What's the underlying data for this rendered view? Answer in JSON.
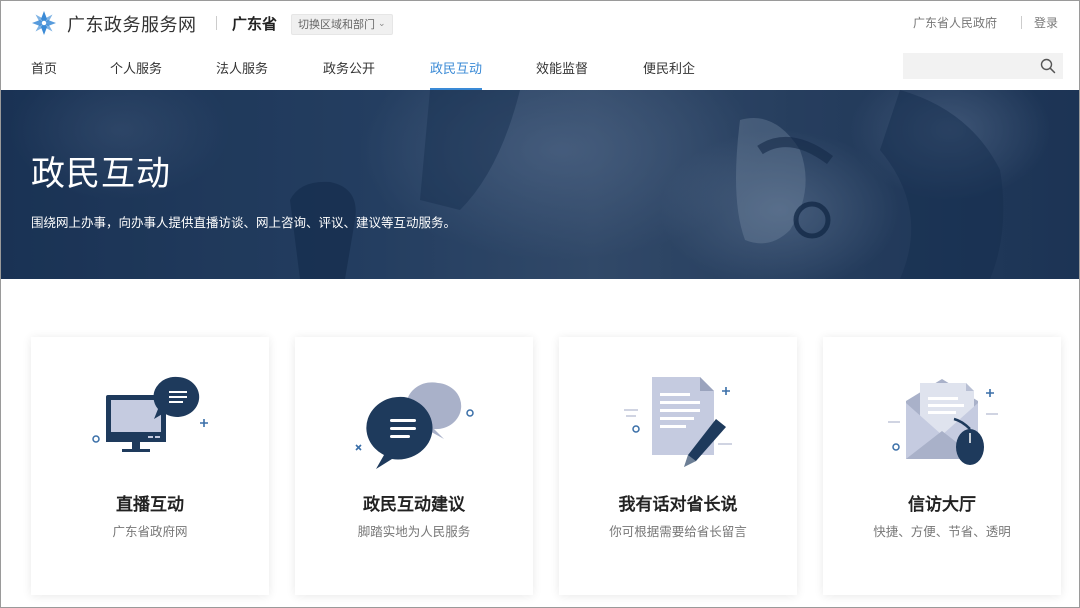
{
  "header": {
    "site_name": "广东政务服务网",
    "region_name": "广东省",
    "region_switch_label": "切换区域和部门",
    "gov_link": "广东省人民政府",
    "login_label": "登录"
  },
  "nav": {
    "items": [
      {
        "label": "首页"
      },
      {
        "label": "个人服务"
      },
      {
        "label": "法人服务"
      },
      {
        "label": "政务公开"
      },
      {
        "label": "政民互动"
      },
      {
        "label": "效能监督"
      },
      {
        "label": "便民利企"
      }
    ],
    "active_index": 4,
    "search": {
      "value": "",
      "placeholder": ""
    }
  },
  "banner": {
    "title": "政民互动",
    "subtitle": "围绕网上办事，向办事人提供直播访谈、网上咨询、评议、建议等互动服务。"
  },
  "cards": [
    {
      "title": "直播互动",
      "desc": "广东省政府网",
      "icon": "monitor-chat-icon"
    },
    {
      "title": "政民互动建议",
      "desc": "脚踏实地为人民服务",
      "icon": "speech-bubbles-icon"
    },
    {
      "title": "我有话对省长说",
      "desc": "你可根据需要给省长留言",
      "icon": "document-pen-icon"
    },
    {
      "title": "信访大厅",
      "desc": "快捷、方便、节省、透明",
      "icon": "envelope-mouse-icon"
    }
  ],
  "colors": {
    "accent": "#3a8ad6",
    "banner_dark": "#1c3657",
    "icon_navy": "#1e3a5c",
    "icon_light": "#c5cbe0"
  }
}
